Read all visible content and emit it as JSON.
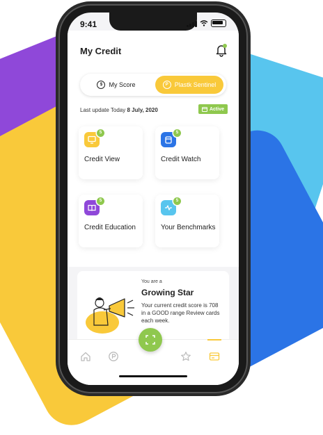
{
  "status": {
    "time": "9:41"
  },
  "header": {
    "title": "My Credit"
  },
  "segments": {
    "left": "My Score",
    "right": "Plastk Sentinel"
  },
  "update": {
    "prefix": "Last update Today",
    "date": "8 July, 2020",
    "badge": "Active"
  },
  "cards": [
    {
      "label": "Credit View",
      "badge": "5",
      "color": "#f9c93a",
      "icon": "monitor-icon"
    },
    {
      "label": "Credit Watch",
      "badge": "5",
      "color": "#2b74e6",
      "icon": "clipboard-icon"
    },
    {
      "label": "Credit Education",
      "badge": "5",
      "color": "#8f48d9",
      "icon": "book-icon"
    },
    {
      "label": "Your Benchmarks",
      "badge": "5",
      "color": "#58c5ee",
      "icon": "activity-icon"
    }
  ],
  "promo": {
    "small": "You are a",
    "head": "Growing Star",
    "body": "Your current credit score is 708 in a GOOD range Review cards each week."
  },
  "colors": {
    "accent": "#f9c93a",
    "green": "#8fc84e",
    "purple": "#8f48d9",
    "blue": "#2b74e6",
    "cyan": "#58c5ee"
  }
}
